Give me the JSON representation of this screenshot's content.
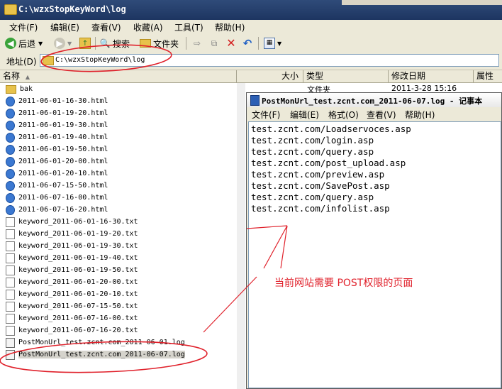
{
  "window": {
    "title": "C:\\wzxStopKeyWord\\log"
  },
  "menu": [
    "文件(F)",
    "编辑(E)",
    "查看(V)",
    "收藏(A)",
    "工具(T)",
    "帮助(H)"
  ],
  "toolbar": {
    "back": "后退",
    "search": "搜索",
    "folders": "文件夹"
  },
  "address": {
    "label": "地址(D)",
    "value": "C:\\wzxStopKeyWord\\log"
  },
  "columns": {
    "name": "名称",
    "size": "大小",
    "type": "类型",
    "modified": "修改日期",
    "attr": "属性"
  },
  "folder_row": {
    "name": "bak",
    "type": "文件夹",
    "modified": "2011-3-28 15:16"
  },
  "files": [
    {
      "name": "2011-06-01-16-30.html",
      "kind": "html"
    },
    {
      "name": "2011-06-01-19-20.html",
      "kind": "html"
    },
    {
      "name": "2011-06-01-19-30.html",
      "kind": "html"
    },
    {
      "name": "2011-06-01-19-40.html",
      "kind": "html"
    },
    {
      "name": "2011-06-01-19-50.html",
      "kind": "html"
    },
    {
      "name": "2011-06-01-20-00.html",
      "kind": "html"
    },
    {
      "name": "2011-06-01-20-10.html",
      "kind": "html"
    },
    {
      "name": "2011-06-07-15-50.html",
      "kind": "html"
    },
    {
      "name": "2011-06-07-16-00.html",
      "kind": "html"
    },
    {
      "name": "2011-06-07-16-20.html",
      "kind": "html"
    },
    {
      "name": "keyword_2011-06-01-16-30.txt",
      "kind": "txt"
    },
    {
      "name": "keyword_2011-06-01-19-20.txt",
      "kind": "txt"
    },
    {
      "name": "keyword_2011-06-01-19-30.txt",
      "kind": "txt"
    },
    {
      "name": "keyword_2011-06-01-19-40.txt",
      "kind": "txt"
    },
    {
      "name": "keyword_2011-06-01-19-50.txt",
      "kind": "txt"
    },
    {
      "name": "keyword_2011-06-01-20-00.txt",
      "kind": "txt"
    },
    {
      "name": "keyword_2011-06-01-20-10.txt",
      "kind": "txt"
    },
    {
      "name": "keyword_2011-06-07-15-50.txt",
      "kind": "txt"
    },
    {
      "name": "keyword_2011-06-07-16-00.txt",
      "kind": "txt"
    },
    {
      "name": "keyword_2011-06-07-16-20.txt",
      "kind": "txt"
    },
    {
      "name": "PostMonUrl_test.zcnt.com_2011-06-01.log",
      "kind": "log"
    },
    {
      "name": "PostMonUrl_test.zcnt.com_2011-06-07.log",
      "kind": "log"
    }
  ],
  "notepad": {
    "title": "PostMonUrl_test.zcnt.com_2011-06-07.log - 记事本",
    "menu": [
      "文件(F)",
      "编辑(E)",
      "格式(O)",
      "查看(V)",
      "帮助(H)"
    ],
    "lines": [
      "test.zcnt.com/Loadservoces.asp",
      "test.zcnt.com/login.asp",
      "test.zcnt.com/query.asp",
      "test.zcnt.com/post_upload.asp",
      "test.zcnt.com/preview.asp",
      "test.zcnt.com/SavePost.asp",
      "test.zcnt.com/query.asp",
      "test.zcnt.com/infolist.asp"
    ]
  },
  "annotation": "当前网站需要 POST权限的页面",
  "colors": {
    "title_bar": "#2f4b79",
    "annotation": "#e0212b",
    "chrome": "#ece9d8"
  }
}
